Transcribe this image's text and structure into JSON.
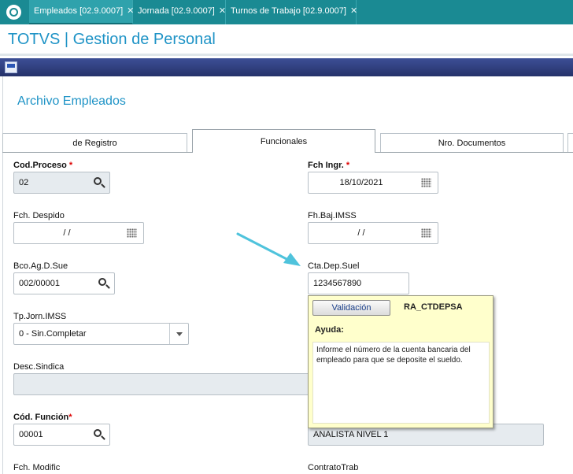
{
  "top_tabs": [
    {
      "label": "Empleados [02.9.0007]",
      "active": true
    },
    {
      "label": "Jornada [02.9.0007]",
      "active": false
    },
    {
      "label": "Turnos de Trabajo [02.9.0007]",
      "active": false
    }
  ],
  "app": {
    "title": "TOTVS | Gestion de Personal"
  },
  "form": {
    "title": "Archivo Empleados"
  },
  "folder_tabs": [
    {
      "label": "de Registro",
      "active": false
    },
    {
      "label": "Funcionales",
      "active": true
    },
    {
      "label": "Nro. Documentos",
      "active": false
    }
  ],
  "fields": {
    "cod_proceso": {
      "label": "Cod.Proceso",
      "required_mark": "*",
      "value": "02"
    },
    "fch_ingr": {
      "label": "Fch Ingr.",
      "required_mark": "*",
      "value": "18/10/2021"
    },
    "fch_despido": {
      "label": "Fch. Despido",
      "value": "/ /"
    },
    "fh_baj_imss": {
      "label": "Fh.Baj.IMSS",
      "value": "/ /"
    },
    "bco_ag_sue": {
      "label": "Bco.Ag.D.Sue",
      "value": "002/00001"
    },
    "cta_dep_suel": {
      "label": "Cta.Dep.Suel",
      "value": "1234567890"
    },
    "tp_jorn_imss": {
      "label": "Tp.Jorn.IMSS",
      "value": "0 - Sin.Completar"
    },
    "desc_sindica": {
      "label": "Desc.Sindica",
      "value": ""
    },
    "cod_funcion": {
      "label": "Cód. Función",
      "required_mark": "*",
      "value": "00001"
    },
    "desc_funcion": {
      "value": "ANALISTA NIVEL 1"
    },
    "fch_modific": {
      "label": "Fch. Modific"
    },
    "contrato_trab": {
      "label": "ContratoTrab"
    }
  },
  "help_popup": {
    "button_label": "Validación",
    "field_name": "RA_CTDEPSA",
    "subtitle": "Ayuda:",
    "text": "Informe el número de la cuenta bancaria del empleado para que se deposite el sueldo."
  },
  "colors": {
    "accent": "#1a8a93",
    "title": "#1e93c6",
    "strip": "#2b3b7a",
    "required": "#dd0000",
    "popup_bg": "#ffffcc",
    "arrow": "#4fc3dc"
  }
}
